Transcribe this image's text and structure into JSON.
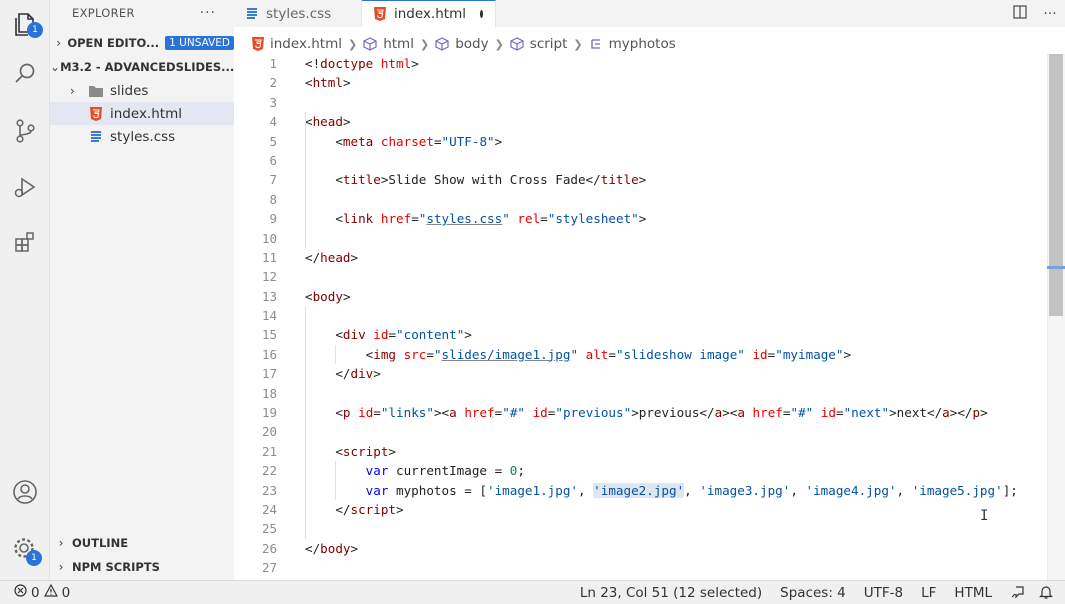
{
  "activity": {
    "explorer_badge": "1",
    "settings_badge": "1"
  },
  "sidebar": {
    "title": "EXPLORER",
    "more": "···",
    "open_editors": {
      "label": "OPEN EDITO...",
      "badge": "1 UNSAVED"
    },
    "folder": {
      "label": "M3.2 - ADVANCEDSLIDES..."
    },
    "items": [
      {
        "label": "slides",
        "type": "folder"
      },
      {
        "label": "index.html",
        "type": "html"
      },
      {
        "label": "styles.css",
        "type": "css"
      }
    ],
    "outline": "OUTLINE",
    "npm_scripts": "NPM SCRIPTS"
  },
  "tabs": [
    {
      "label": "styles.css",
      "type": "css",
      "active": false
    },
    {
      "label": "index.html",
      "type": "html",
      "active": true,
      "dirty": true
    }
  ],
  "breadcrumb": {
    "file": "index.html",
    "path": [
      "html",
      "body",
      "script",
      "myphotos"
    ]
  },
  "editor": {
    "line_numbers": [
      "1",
      "2",
      "3",
      "4",
      "5",
      "6",
      "7",
      "8",
      "9",
      "10",
      "11",
      "12",
      "13",
      "14",
      "15",
      "16",
      "17",
      "18",
      "19",
      "20",
      "21",
      "22",
      "23",
      "24",
      "25",
      "26",
      "27"
    ],
    "lines": [
      [
        [
          "t-punc",
          "<!"
        ],
        [
          "t-tag",
          "doctype"
        ],
        [
          "t-punc",
          " "
        ],
        [
          "t-attr",
          "html"
        ],
        [
          "t-punc",
          ">"
        ]
      ],
      [
        [
          "t-punc",
          "<"
        ],
        [
          "t-tag",
          "html"
        ],
        [
          "t-punc",
          ">"
        ]
      ],
      [],
      [
        [
          "t-punc",
          "<"
        ],
        [
          "t-tag",
          "head"
        ],
        [
          "t-punc",
          ">"
        ]
      ],
      [
        [
          "t-punc",
          "    <"
        ],
        [
          "t-tag",
          "meta"
        ],
        [
          "t-punc",
          " "
        ],
        [
          "t-attr",
          "charset"
        ],
        [
          "t-punc",
          "="
        ],
        [
          "t-str",
          "\"UTF-8\""
        ],
        [
          "t-punc",
          ">"
        ]
      ],
      [],
      [
        [
          "t-punc",
          "    <"
        ],
        [
          "t-tag",
          "title"
        ],
        [
          "t-punc",
          ">Slide Show with Cross Fade</"
        ],
        [
          "t-tag",
          "title"
        ],
        [
          "t-punc",
          ">"
        ]
      ],
      [],
      [
        [
          "t-punc",
          "    <"
        ],
        [
          "t-tag",
          "link"
        ],
        [
          "t-punc",
          " "
        ],
        [
          "t-attr",
          "href"
        ],
        [
          "t-punc",
          "="
        ],
        [
          "t-str",
          "\""
        ],
        [
          "t-str u",
          "styles.css"
        ],
        [
          "t-str",
          "\""
        ],
        [
          "t-punc",
          " "
        ],
        [
          "t-attr",
          "rel"
        ],
        [
          "t-punc",
          "="
        ],
        [
          "t-str",
          "\"stylesheet\""
        ],
        [
          "t-punc",
          ">"
        ]
      ],
      [],
      [
        [
          "t-punc",
          "</"
        ],
        [
          "t-tag",
          "head"
        ],
        [
          "t-punc",
          ">"
        ]
      ],
      [],
      [
        [
          "t-punc",
          "<"
        ],
        [
          "t-tag",
          "body"
        ],
        [
          "t-punc",
          ">"
        ]
      ],
      [],
      [
        [
          "t-punc",
          "    <"
        ],
        [
          "t-tag",
          "div"
        ],
        [
          "t-punc",
          " "
        ],
        [
          "t-attr",
          "id"
        ],
        [
          "t-punc",
          "="
        ],
        [
          "t-str",
          "\"content\""
        ],
        [
          "t-punc",
          ">"
        ]
      ],
      [
        [
          "t-punc",
          "        <"
        ],
        [
          "t-tag",
          "img"
        ],
        [
          "t-punc",
          " "
        ],
        [
          "t-attr",
          "src"
        ],
        [
          "t-punc",
          "="
        ],
        [
          "t-str",
          "\""
        ],
        [
          "t-str u",
          "slides/image1.jpg"
        ],
        [
          "t-str",
          "\""
        ],
        [
          "t-punc",
          " "
        ],
        [
          "t-attr",
          "alt"
        ],
        [
          "t-punc",
          "="
        ],
        [
          "t-str",
          "\"slideshow image\""
        ],
        [
          "t-punc",
          " "
        ],
        [
          "t-attr",
          "id"
        ],
        [
          "t-punc",
          "="
        ],
        [
          "t-str",
          "\"myimage\""
        ],
        [
          "t-punc",
          ">"
        ]
      ],
      [
        [
          "t-punc",
          "    </"
        ],
        [
          "t-tag",
          "div"
        ],
        [
          "t-punc",
          ">"
        ]
      ],
      [],
      [
        [
          "t-punc",
          "    <"
        ],
        [
          "t-tag",
          "p"
        ],
        [
          "t-punc",
          " "
        ],
        [
          "t-attr",
          "id"
        ],
        [
          "t-punc",
          "="
        ],
        [
          "t-str",
          "\"links\""
        ],
        [
          "t-punc",
          "><"
        ],
        [
          "t-tag",
          "a"
        ],
        [
          "t-punc",
          " "
        ],
        [
          "t-attr",
          "href"
        ],
        [
          "t-punc",
          "="
        ],
        [
          "t-str",
          "\"#\""
        ],
        [
          "t-punc",
          " "
        ],
        [
          "t-attr",
          "id"
        ],
        [
          "t-punc",
          "="
        ],
        [
          "t-str",
          "\"previous\""
        ],
        [
          "t-punc",
          ">previous</"
        ],
        [
          "t-tag",
          "a"
        ],
        [
          "t-punc",
          "><"
        ],
        [
          "t-tag",
          "a"
        ],
        [
          "t-punc",
          " "
        ],
        [
          "t-attr",
          "href"
        ],
        [
          "t-punc",
          "="
        ],
        [
          "t-str",
          "\"#\""
        ],
        [
          "t-punc",
          " "
        ],
        [
          "t-attr",
          "id"
        ],
        [
          "t-punc",
          "="
        ],
        [
          "t-str",
          "\"next\""
        ],
        [
          "t-punc",
          ">next</"
        ],
        [
          "t-tag",
          "a"
        ],
        [
          "t-punc",
          "></"
        ],
        [
          "t-tag",
          "p"
        ],
        [
          "t-punc",
          ">"
        ]
      ],
      [],
      [
        [
          "t-punc",
          "    <"
        ],
        [
          "t-tag",
          "script"
        ],
        [
          "t-punc",
          ">"
        ]
      ],
      [
        [
          "t-punc",
          "        "
        ],
        [
          "t-kw",
          "var"
        ],
        [
          "t-punc",
          " currentImage = "
        ],
        [
          "t-num",
          "0"
        ],
        [
          "t-punc",
          ";"
        ]
      ],
      [
        [
          "t-punc",
          "        "
        ],
        [
          "t-kw",
          "var"
        ],
        [
          "t-punc",
          " myphotos = ["
        ],
        [
          "t-str",
          "'image1.jpg'"
        ],
        [
          "t-punc",
          ", "
        ],
        [
          "t-str hl",
          "'image2.jpg'"
        ],
        [
          "t-punc",
          ", "
        ],
        [
          "t-str",
          "'image3.jpg'"
        ],
        [
          "t-punc",
          ", "
        ],
        [
          "t-str",
          "'image4.jpg'"
        ],
        [
          "t-punc",
          ", "
        ],
        [
          "t-str",
          "'image5.jpg'"
        ],
        [
          "t-punc",
          "];"
        ]
      ],
      [
        [
          "t-punc",
          "    </"
        ],
        [
          "t-tag",
          "script"
        ],
        [
          "t-punc",
          ">"
        ]
      ],
      [],
      [
        [
          "t-punc",
          "</"
        ],
        [
          "t-tag",
          "body"
        ],
        [
          "t-punc",
          ">"
        ]
      ],
      []
    ]
  },
  "status": {
    "errors": "0",
    "warnings": "0",
    "position": "Ln 23, Col 51 (12 selected)",
    "spaces": "Spaces: 4",
    "encoding": "UTF-8",
    "eol": "LF",
    "language": "HTML"
  }
}
